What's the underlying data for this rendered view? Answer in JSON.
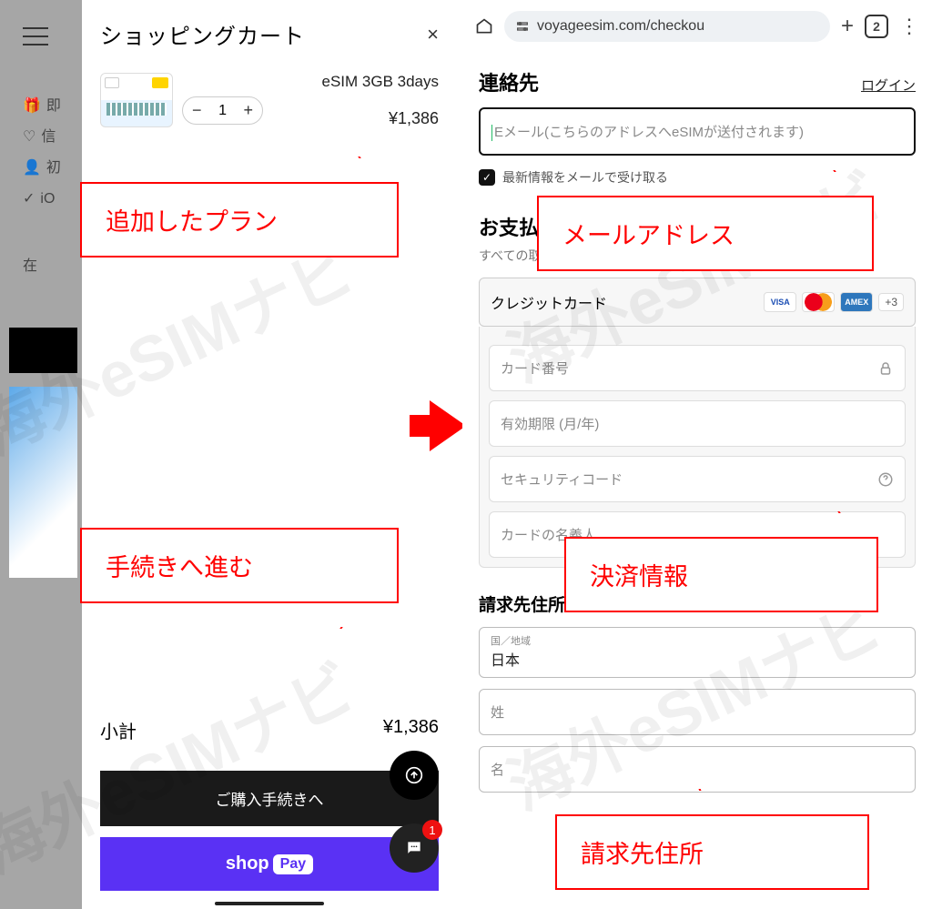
{
  "watermark": "海外eSIMナビ",
  "back": {
    "items": [
      "即",
      "信",
      "初",
      "iO",
      "在"
    ]
  },
  "cart": {
    "title": "ショッピングカート",
    "close_symbol": "×",
    "item": {
      "name": "eSIM 3GB 3days",
      "price": "¥1,386",
      "qty": "1",
      "minus": "−",
      "plus": "+"
    },
    "subtotal_label": "小計",
    "subtotal_value": "¥1,386",
    "checkout_label": "ご購入手続きへ",
    "shoppay_prefix": "shop",
    "shoppay_pill": "Pay",
    "chat_badge": "1"
  },
  "browser": {
    "url": "voyageesim.com/checkou",
    "tab_count": "2",
    "plus": "+",
    "kebab": "⋮"
  },
  "checkout": {
    "contact_title": "連絡先",
    "login": "ログイン",
    "email_placeholder": "Eメール(こちらのアドレスへeSIMが送付されます)",
    "consent_label": "最新情報をメールで受け取る",
    "payment_title": "お支払い",
    "payment_desc": "すべての取引は安全で、暗号化されています。",
    "credit_card_label": "クレジットカード",
    "plus3": "+3",
    "card_number": "カード番号",
    "expiry": "有効期限 (月/年)",
    "cvv": "セキュリティコード",
    "name_on_card": "カードの名義人",
    "billing_title": "請求先住所",
    "country_label": "国／地域",
    "country_value": "日本",
    "lastname": "姓",
    "firstname": "名"
  },
  "callouts": {
    "plan": "追加したプラン",
    "proceed": "手続きへ進む",
    "email": "メールアドレス",
    "payment": "決済情報",
    "billing": "請求先住所"
  }
}
